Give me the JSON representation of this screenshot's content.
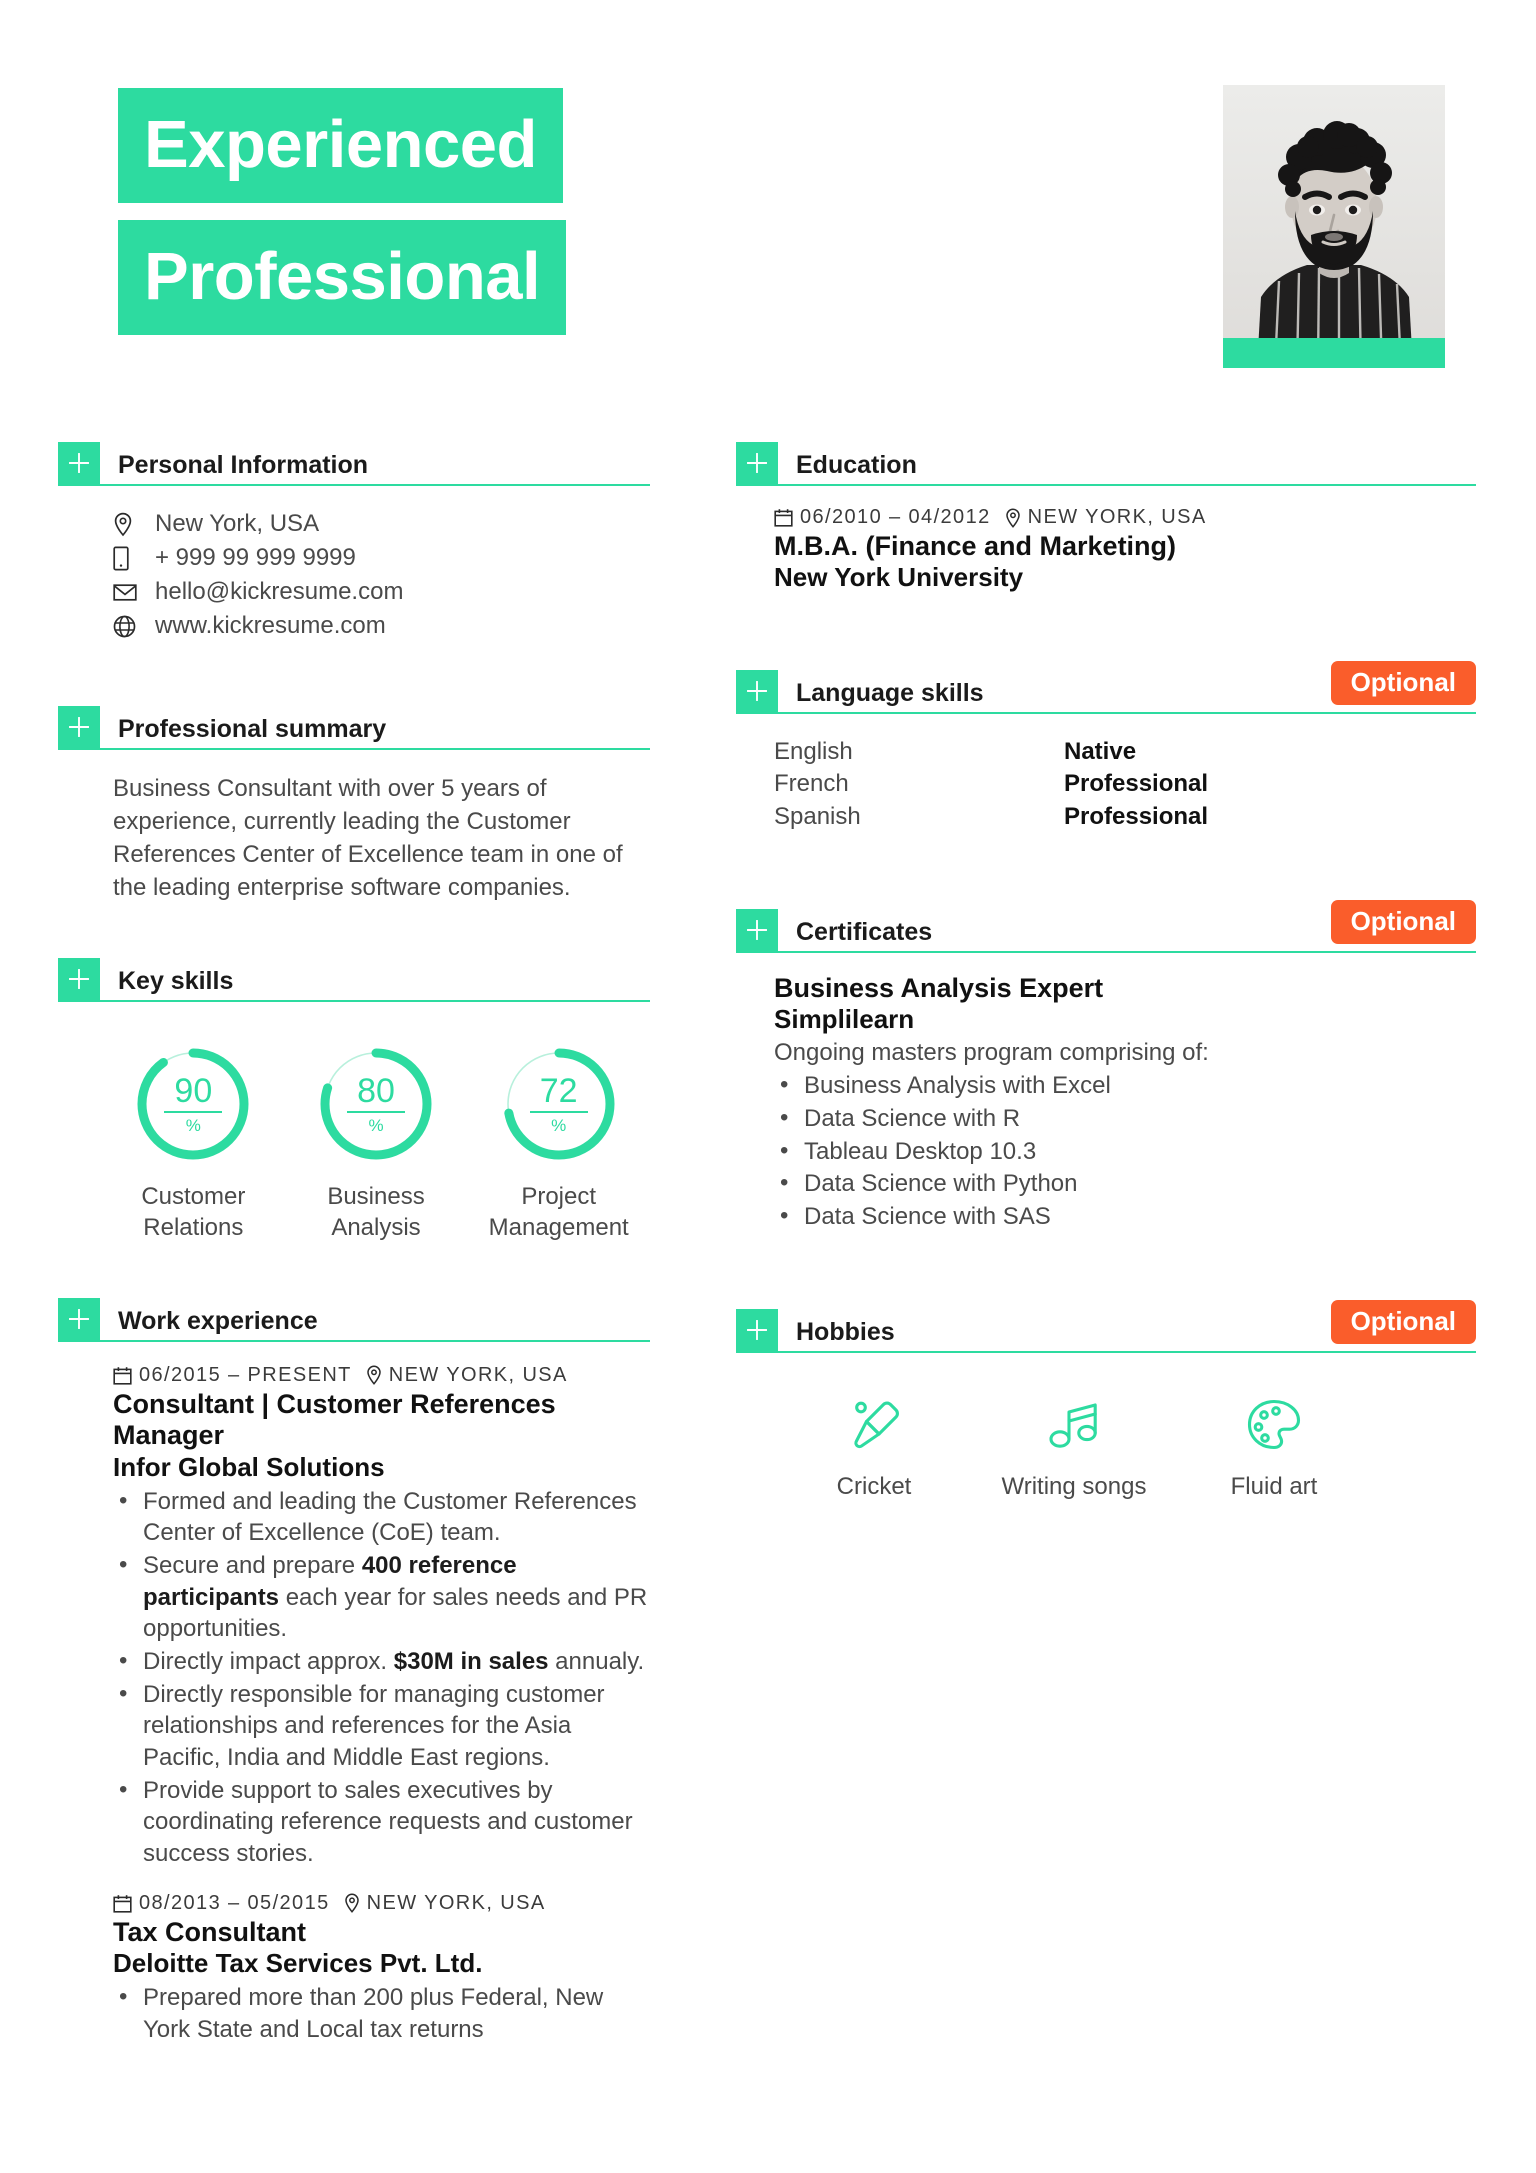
{
  "theme": {
    "accent_green": "#2ddba0",
    "badge_orange": "#fa5d2b",
    "text_dark": "#111111",
    "text_body": "#4a4a4a"
  },
  "header": {
    "title_line_1": "Experienced",
    "title_line_2": "Professional",
    "photo_alt": "profile-photo"
  },
  "left_column": {
    "personal_information": {
      "heading": "Personal Information",
      "contacts": [
        {
          "icon": "location-pin-icon",
          "value": "New York, USA"
        },
        {
          "icon": "phone-icon",
          "value": "+ 999 99 999 9999"
        },
        {
          "icon": "envelope-icon",
          "value": "hello@kickresume.com"
        },
        {
          "icon": "globe-icon",
          "value": "www.kickresume.com"
        }
      ]
    },
    "professional_summary": {
      "heading": "Professional summary",
      "text": "Business Consultant with over 5 years of experience, currently leading the Customer References Center of Excellence team in one of the leading enterprise software companies."
    },
    "key_skills": {
      "heading": "Key skills",
      "gauges": [
        {
          "value": 90,
          "unit": "%",
          "label": "Customer Relations"
        },
        {
          "value": 80,
          "unit": "%",
          "label": "Business Analysis"
        },
        {
          "value": 72,
          "unit": "%",
          "label": "Project Management"
        }
      ]
    },
    "work_experience": {
      "heading": "Work experience",
      "jobs": [
        {
          "date": "06/2015 – PRESENT",
          "location": "NEW YORK, USA",
          "title": "Consultant | Customer References Manager",
          "organization": "Infor Global Solutions",
          "bullets": [
            {
              "parts": [
                {
                  "t": "Formed and leading the Customer References Center of Excellence (CoE) team.",
                  "b": false
                }
              ]
            },
            {
              "parts": [
                {
                  "t": "Secure and prepare ",
                  "b": false
                },
                {
                  "t": "400 reference participants",
                  "b": true
                },
                {
                  "t": " each year for sales needs and PR opportunities.",
                  "b": false
                }
              ]
            },
            {
              "parts": [
                {
                  "t": "Directly impact approx. ",
                  "b": false
                },
                {
                  "t": "$30M in sales",
                  "b": true
                },
                {
                  "t": " annualy.",
                  "b": false
                }
              ]
            },
            {
              "parts": [
                {
                  "t": "Directly responsible for managing customer relationships and references for the Asia Pacific, India and Middle East regions.",
                  "b": false
                }
              ]
            },
            {
              "parts": [
                {
                  "t": "Provide support to sales executives by coordinating reference requests and customer success stories.",
                  "b": false
                }
              ]
            }
          ]
        },
        {
          "date": "08/2013 – 05/2015",
          "location": "NEW YORK, USA",
          "title": "Tax Consultant",
          "organization": "Deloitte Tax Services Pvt. Ltd.",
          "bullets": [
            {
              "parts": [
                {
                  "t": "Prepared more than 200 plus Federal, New York State and Local tax returns",
                  "b": false
                }
              ]
            }
          ]
        }
      ]
    }
  },
  "right_column": {
    "education": {
      "heading": "Education",
      "entries": [
        {
          "date": "06/2010 – 04/2012",
          "location": "NEW YORK, USA",
          "title": "M.B.A. (Finance and Marketing)",
          "organization": "New York University"
        }
      ]
    },
    "language_skills": {
      "heading": "Language skills",
      "badge": "Optional",
      "languages": [
        {
          "name": "English",
          "level": "Native"
        },
        {
          "name": "French",
          "level": "Professional"
        },
        {
          "name": "Spanish",
          "level": "Professional"
        }
      ]
    },
    "certificates": {
      "heading": "Certificates",
      "badge": "Optional",
      "title": "Business Analysis Expert",
      "organization": "Simplilearn",
      "intro": "Ongoing masters program comprising of:",
      "bullets": [
        "Business Analysis with Excel",
        "Data Science with R",
        "Tableau Desktop 10.3",
        "Data Science with Python",
        "Data Science with SAS"
      ]
    },
    "hobbies": {
      "heading": "Hobbies",
      "badge": "Optional",
      "items": [
        {
          "icon": "cricket-bat-icon",
          "label": "Cricket"
        },
        {
          "icon": "music-notes-icon",
          "label": "Writing songs"
        },
        {
          "icon": "paint-palette-icon",
          "label": "Fluid art"
        }
      ]
    }
  }
}
